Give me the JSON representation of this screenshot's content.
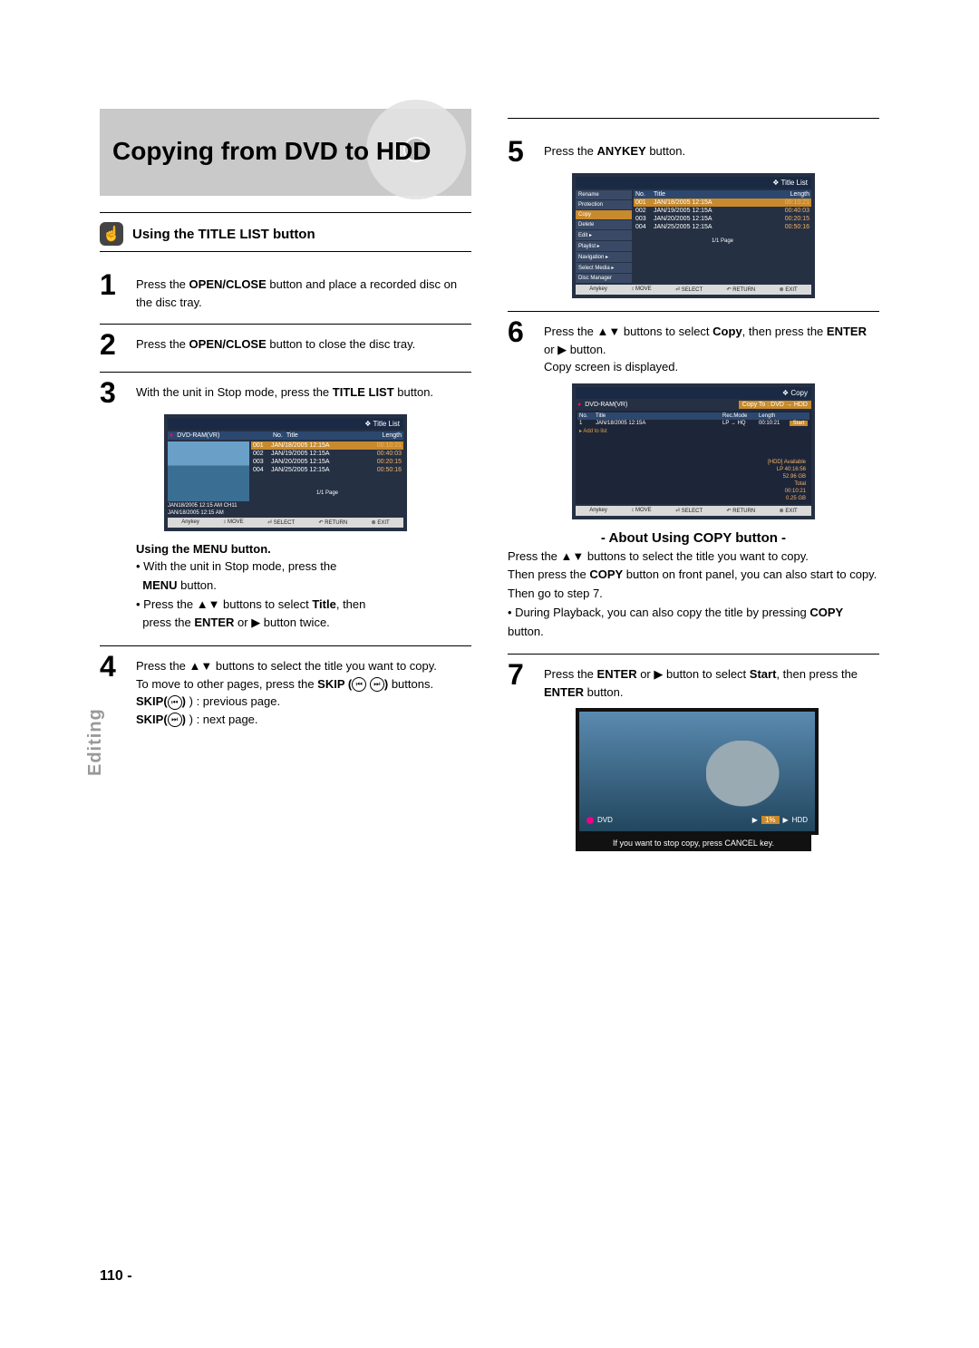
{
  "page": {
    "section_tab": "Editing",
    "page_number": "110 -"
  },
  "title": "Copying from DVD to HDD",
  "heading_left": "Using the TITLE LIST button",
  "steps": {
    "s1": {
      "num": "1",
      "body_before": "Press the ",
      "bold1": "OPEN/CLOSE",
      "body_after": " button and place a recorded disc on the disc tray."
    },
    "s2": {
      "num": "2",
      "body": "Press the ",
      "bold1": "OPEN/CLOSE",
      "body_after": " button to close the disc tray."
    },
    "s3": {
      "num": "3",
      "body_a": "With the unit in Stop mode, press the ",
      "bold1": "TITLE LIST",
      "body_b": " button."
    },
    "menu_head": "Using the MENU button.",
    "menu_lines": {
      "l1": "With the unit in Stop mode, press the",
      "l2a": "MENU",
      "l2b": " button.",
      "l3a": "Press the ",
      "arrows": "▲▼",
      "l3b": " buttons to select ",
      "title": "Title",
      "l3c": ", then",
      "l4a": "press the ",
      "enter": "ENTER",
      "l4b": " or ",
      "right": "▶",
      "l4c": " button twice."
    },
    "s4": {
      "num": "4",
      "l1a": "Press the ",
      "arrows": "▲▼",
      "l1b": " buttons to select the title you want to copy.",
      "l2a": "To move to other pages, press the ",
      "skip": "SKIP (",
      "skip2": ")",
      "l3a": "SKIP(",
      "l3b": ") : previous page.",
      "l4a": "SKIP(",
      "l4b": ") : next page."
    },
    "s5": {
      "num": "5",
      "l1a": "Press the ",
      "bold": "ANYKEY",
      "l1b": " button."
    },
    "s6": {
      "num": "6",
      "l1a": "Press the ",
      "arrows": "▲▼",
      "l1b": " buttons to select ",
      "copy": "Copy",
      "l1c": ", then press the ",
      "enter": "ENTER",
      "l1d": " or ",
      "right": "▶",
      "l1e": " button.",
      "l2": "Copy screen is displayed."
    },
    "about_head": "- About Using COPY button -",
    "about": {
      "l1a": "Press the ",
      "arrows": "▲▼",
      "l1b": " buttons to select the title you want to copy.",
      "l2a": "Then press the ",
      "copybtn": "COPY",
      "l2b": " button on front panel, you can also start to copy.",
      "l3a": "Then go to step 7.",
      "l4a": "During Playback, you can also copy the title by pressing ",
      "copybtn2": "COPY",
      "l4b": " button."
    },
    "s7": {
      "num": "7",
      "l1a": "Press the ",
      "enter": "ENTER",
      "l1b": " or ",
      "right": "▶",
      "l1c": " button to select ",
      "start": "Start",
      "l1d": ", then press the ",
      "enter2": "ENTER",
      "l1e": " button."
    }
  },
  "osd1": {
    "header": "Title List",
    "source": "DVD-RAM(VR)",
    "cols": {
      "no": "No.",
      "title": "Title",
      "len": "Length"
    },
    "rows": [
      {
        "no": "001",
        "title": "JAN/18/2005 12:15A",
        "len": "00:10:21"
      },
      {
        "no": "002",
        "title": "JAN/19/2005 12:15A",
        "len": "00:40:03"
      },
      {
        "no": "003",
        "title": "JAN/20/2005 12:15A",
        "len": "00:20:15"
      },
      {
        "no": "004",
        "title": "JAN/25/2005 12:15A",
        "len": "00:50:16"
      }
    ],
    "info1": "JAN18/2005 12:15 AM CH11",
    "info2": "JAN/18/2005 12:15 AM",
    "page": "1/1 Page",
    "foot": {
      "a": "Anykey",
      "b": "MOVE",
      "c": "SELECT",
      "d": "RETURN",
      "e": "EXIT"
    }
  },
  "osd2": {
    "header": "Title List",
    "menu": [
      "Rename",
      "Protection",
      "Copy",
      "Delete",
      "Edit",
      "Playlist",
      "Navigation",
      "Select Media",
      "Disc Manager"
    ],
    "menu_on": 2,
    "cols": {
      "no": "No.",
      "title": "Title",
      "len": "Length"
    },
    "rows": [
      {
        "no": "001",
        "title": "JAN/18/2005 12:15A",
        "len": "00:10:21"
      },
      {
        "no": "002",
        "title": "JAN/19/2005 12:15A",
        "len": "00:40:03"
      },
      {
        "no": "003",
        "title": "JAN/20/2005 12:15A",
        "len": "00:20:15"
      },
      {
        "no": "004",
        "title": "JAN/25/2005 12:15A",
        "len": "00:50:16"
      }
    ],
    "page": "1/1 Page",
    "foot": {
      "a": "Anykey",
      "b": "MOVE",
      "c": "SELECT",
      "d": "RETURN",
      "e": "EXIT"
    }
  },
  "osd3": {
    "header": "Copy",
    "source": "DVD-RAM(VR)",
    "dest": "Copy To : DVD → HDD",
    "cols": {
      "no": "No.",
      "title": "Title",
      "rec": "Rec.Mode",
      "len": "Length"
    },
    "row": {
      "no": "1",
      "title": "JAN/18/2005 12:15A",
      "rec": "LP → HQ",
      "len": "00:10:21",
      "start": "Start"
    },
    "add": "Add to list",
    "avail_label": "[HDD] Available",
    "avail_lp": "LP   40:16:56",
    "avail_size": "52.96 GB",
    "total": "Total",
    "total_time": "00:10:21",
    "total_size": "0.25 GB",
    "foot": {
      "a": "Anykey",
      "b": "MOVE",
      "c": "SELECT",
      "d": "RETURN",
      "e": "EXIT"
    }
  },
  "playimg": {
    "src_label": "DVD",
    "pct": "1%",
    "dest": "HDD",
    "caption": "If you want to stop copy, press CANCEL key."
  }
}
